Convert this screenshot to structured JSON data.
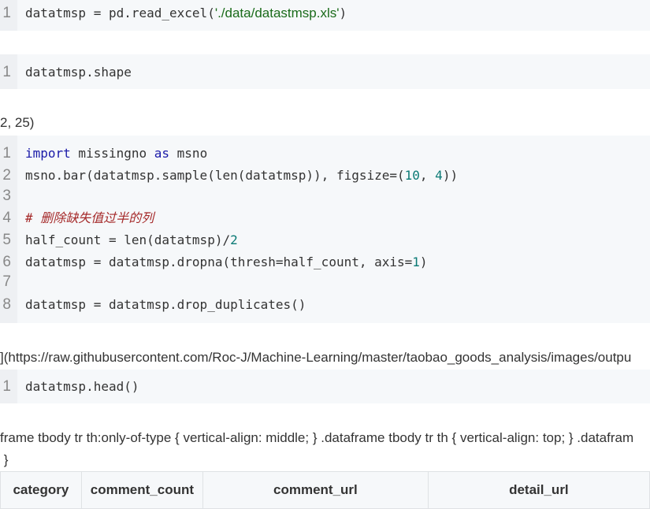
{
  "cells": [
    {
      "lines": [
        {
          "num": "1",
          "parts": [
            {
              "text": "datatmsp = pd.read_excel(",
              "cls": ""
            },
            {
              "text": "'./data/datastmsp.xls'",
              "cls": "str"
            },
            {
              "text": ")",
              "cls": ""
            }
          ]
        }
      ]
    },
    {
      "lines": [
        {
          "num": "1",
          "parts": [
            {
              "text": "datatmsp.shape",
              "cls": ""
            }
          ]
        }
      ]
    },
    {
      "lines": [
        {
          "num": "1",
          "parts": [
            {
              "text": "import",
              "cls": "kw"
            },
            {
              "text": " missingno ",
              "cls": ""
            },
            {
              "text": "as",
              "cls": "kw"
            },
            {
              "text": " msno",
              "cls": ""
            }
          ]
        },
        {
          "num": "2",
          "parts": [
            {
              "text": "msno.bar(datatmsp.sample(len(datatmsp)), figsize=(",
              "cls": ""
            },
            {
              "text": "10",
              "cls": "num"
            },
            {
              "text": ", ",
              "cls": ""
            },
            {
              "text": "4",
              "cls": "num"
            },
            {
              "text": "))",
              "cls": ""
            }
          ]
        },
        {
          "num": "3",
          "parts": []
        },
        {
          "num": "4",
          "parts": [
            {
              "text": "# 删除缺失值过半的列",
              "cls": "cm"
            }
          ]
        },
        {
          "num": "5",
          "parts": [
            {
              "text": "half_count = len(datatmsp)/",
              "cls": ""
            },
            {
              "text": "2",
              "cls": "num"
            }
          ]
        },
        {
          "num": "6",
          "parts": [
            {
              "text": "datatmsp = datatmsp.dropna(thresh=half_count, axis=",
              "cls": ""
            },
            {
              "text": "1",
              "cls": "num"
            },
            {
              "text": ")",
              "cls": ""
            }
          ]
        },
        {
          "num": "7",
          "parts": []
        },
        {
          "num": "8",
          "parts": [
            {
              "text": "datatmsp = datatmsp.drop_duplicates()",
              "cls": ""
            }
          ]
        }
      ]
    },
    {
      "lines": [
        {
          "num": "1",
          "parts": [
            {
              "text": "datatmsp.head()",
              "cls": ""
            }
          ]
        }
      ]
    }
  ],
  "outputs": {
    "shape": "2, 25)",
    "image_link": "](https://raw.githubusercontent.com/Roc-J/Machine-Learning/master/taobao_goods_analysis/images/outpu",
    "css_line1": "frame tbody tr th:only-of-type { vertical-align: middle; } .dataframe tbody tr th { vertical-align: top; } .datafram",
    "css_line2": " }"
  },
  "table": {
    "headers": [
      "category",
      "comment_count",
      "comment_url",
      "detail_url"
    ]
  },
  "colors": {
    "code_bg": "#f6f8fa",
    "string": "#1a6b1a",
    "keyword": "#1a1aa8",
    "number": "#0b7a75",
    "comment": "#a52a2a"
  }
}
